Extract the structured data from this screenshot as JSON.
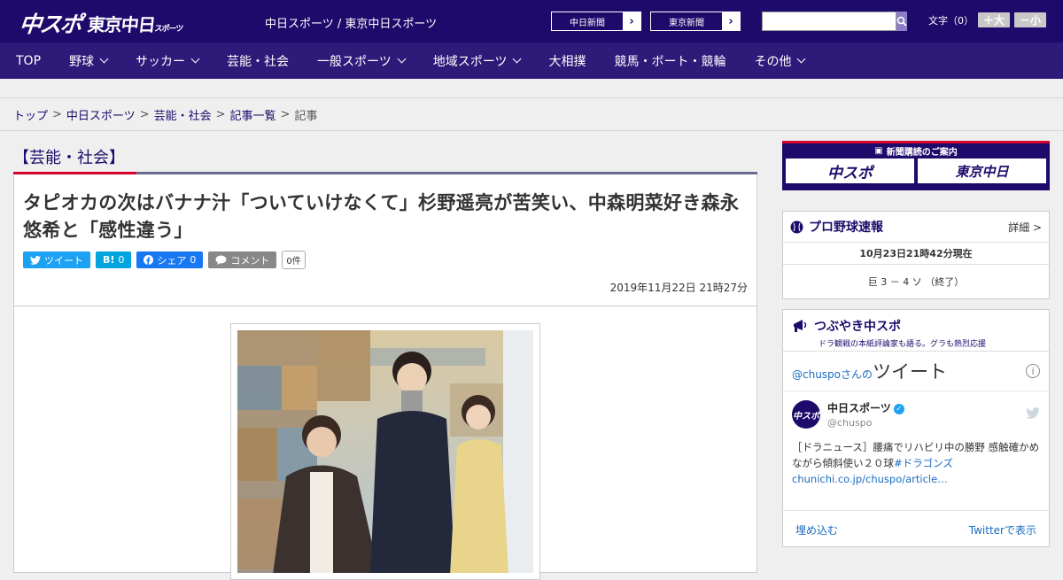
{
  "header": {
    "logo_main": "中スポ",
    "logo_sub": "東京中日",
    "logo_sub_small": "スポーツ",
    "site_title": "中日スポーツ / 東京中日スポーツ",
    "ext_links": [
      "中日新聞",
      "東京新聞"
    ],
    "search_placeholder": "",
    "font_size_label": "文字（0）",
    "font_up": "＋大",
    "font_down": "－小"
  },
  "nav": {
    "items": [
      {
        "label": "TOP",
        "dropdown": false
      },
      {
        "label": "野球",
        "dropdown": true
      },
      {
        "label": "サッカー",
        "dropdown": true
      },
      {
        "label": "芸能・社会",
        "dropdown": false
      },
      {
        "label": "一般スポーツ",
        "dropdown": true
      },
      {
        "label": "地域スポーツ",
        "dropdown": true
      },
      {
        "label": "大相撲",
        "dropdown": false
      },
      {
        "label": "競馬・ボート・競輪",
        "dropdown": false
      },
      {
        "label": "その他",
        "dropdown": true
      }
    ]
  },
  "breadcrumb": {
    "items": [
      "トップ",
      "中日スポーツ",
      "芸能・社会",
      "記事一覧"
    ],
    "current": "記事"
  },
  "article": {
    "category": "【芸能・社会】",
    "headline": "タピオカの次はバナナ汁「ついていけなくて」杉野遥亮が苦笑い、中森明菜好き森永悠希と「感性違う」",
    "share": {
      "tweet": "ツイート",
      "hatena": "B!",
      "hatena_count": "0",
      "facebook": "シェア",
      "facebook_count": "0",
      "comment": "コメント",
      "comment_count": "0件"
    },
    "date": "2019年11月22日 21時27分"
  },
  "sidebar": {
    "subscribe_head": "新聞購読のご案内",
    "subscribe_logos": [
      "中スポ",
      "東京中日"
    ],
    "baseball": {
      "title": "プロ野球速報",
      "more": "詳細 >",
      "time": "10月23日21時42分現在",
      "score": "巨 3 － 4 ソ （終了）"
    },
    "tsubuyaki": {
      "title": "つぶやき中スポ",
      "subtitle": "ドラ観戦の本紙評論家も語る。グラも熱烈応援",
      "embed_user": "@chuspoさんの",
      "embed_title": "ツイート",
      "info_icon": "i",
      "tweet_name": "中日スポーツ",
      "tweet_handle": "@chuspo",
      "avatar_text": "中スポ",
      "tweet_text": "［ドラニュース］腰痛でリハビリ中の勝野 感触確かめながら傾斜使い２０球",
      "tweet_hashtag": "#ドラゴンズ",
      "tweet_link": "chunichi.co.jp/chuspo/article…",
      "embed_label": "埋め込む",
      "view_on_twitter": "Twitterで表示"
    }
  },
  "colors": {
    "header_bg": "#1d0a6b",
    "nav_bg": "#2d1a79",
    "accent_red": "#d6002a",
    "link": "#1a6bc1"
  }
}
